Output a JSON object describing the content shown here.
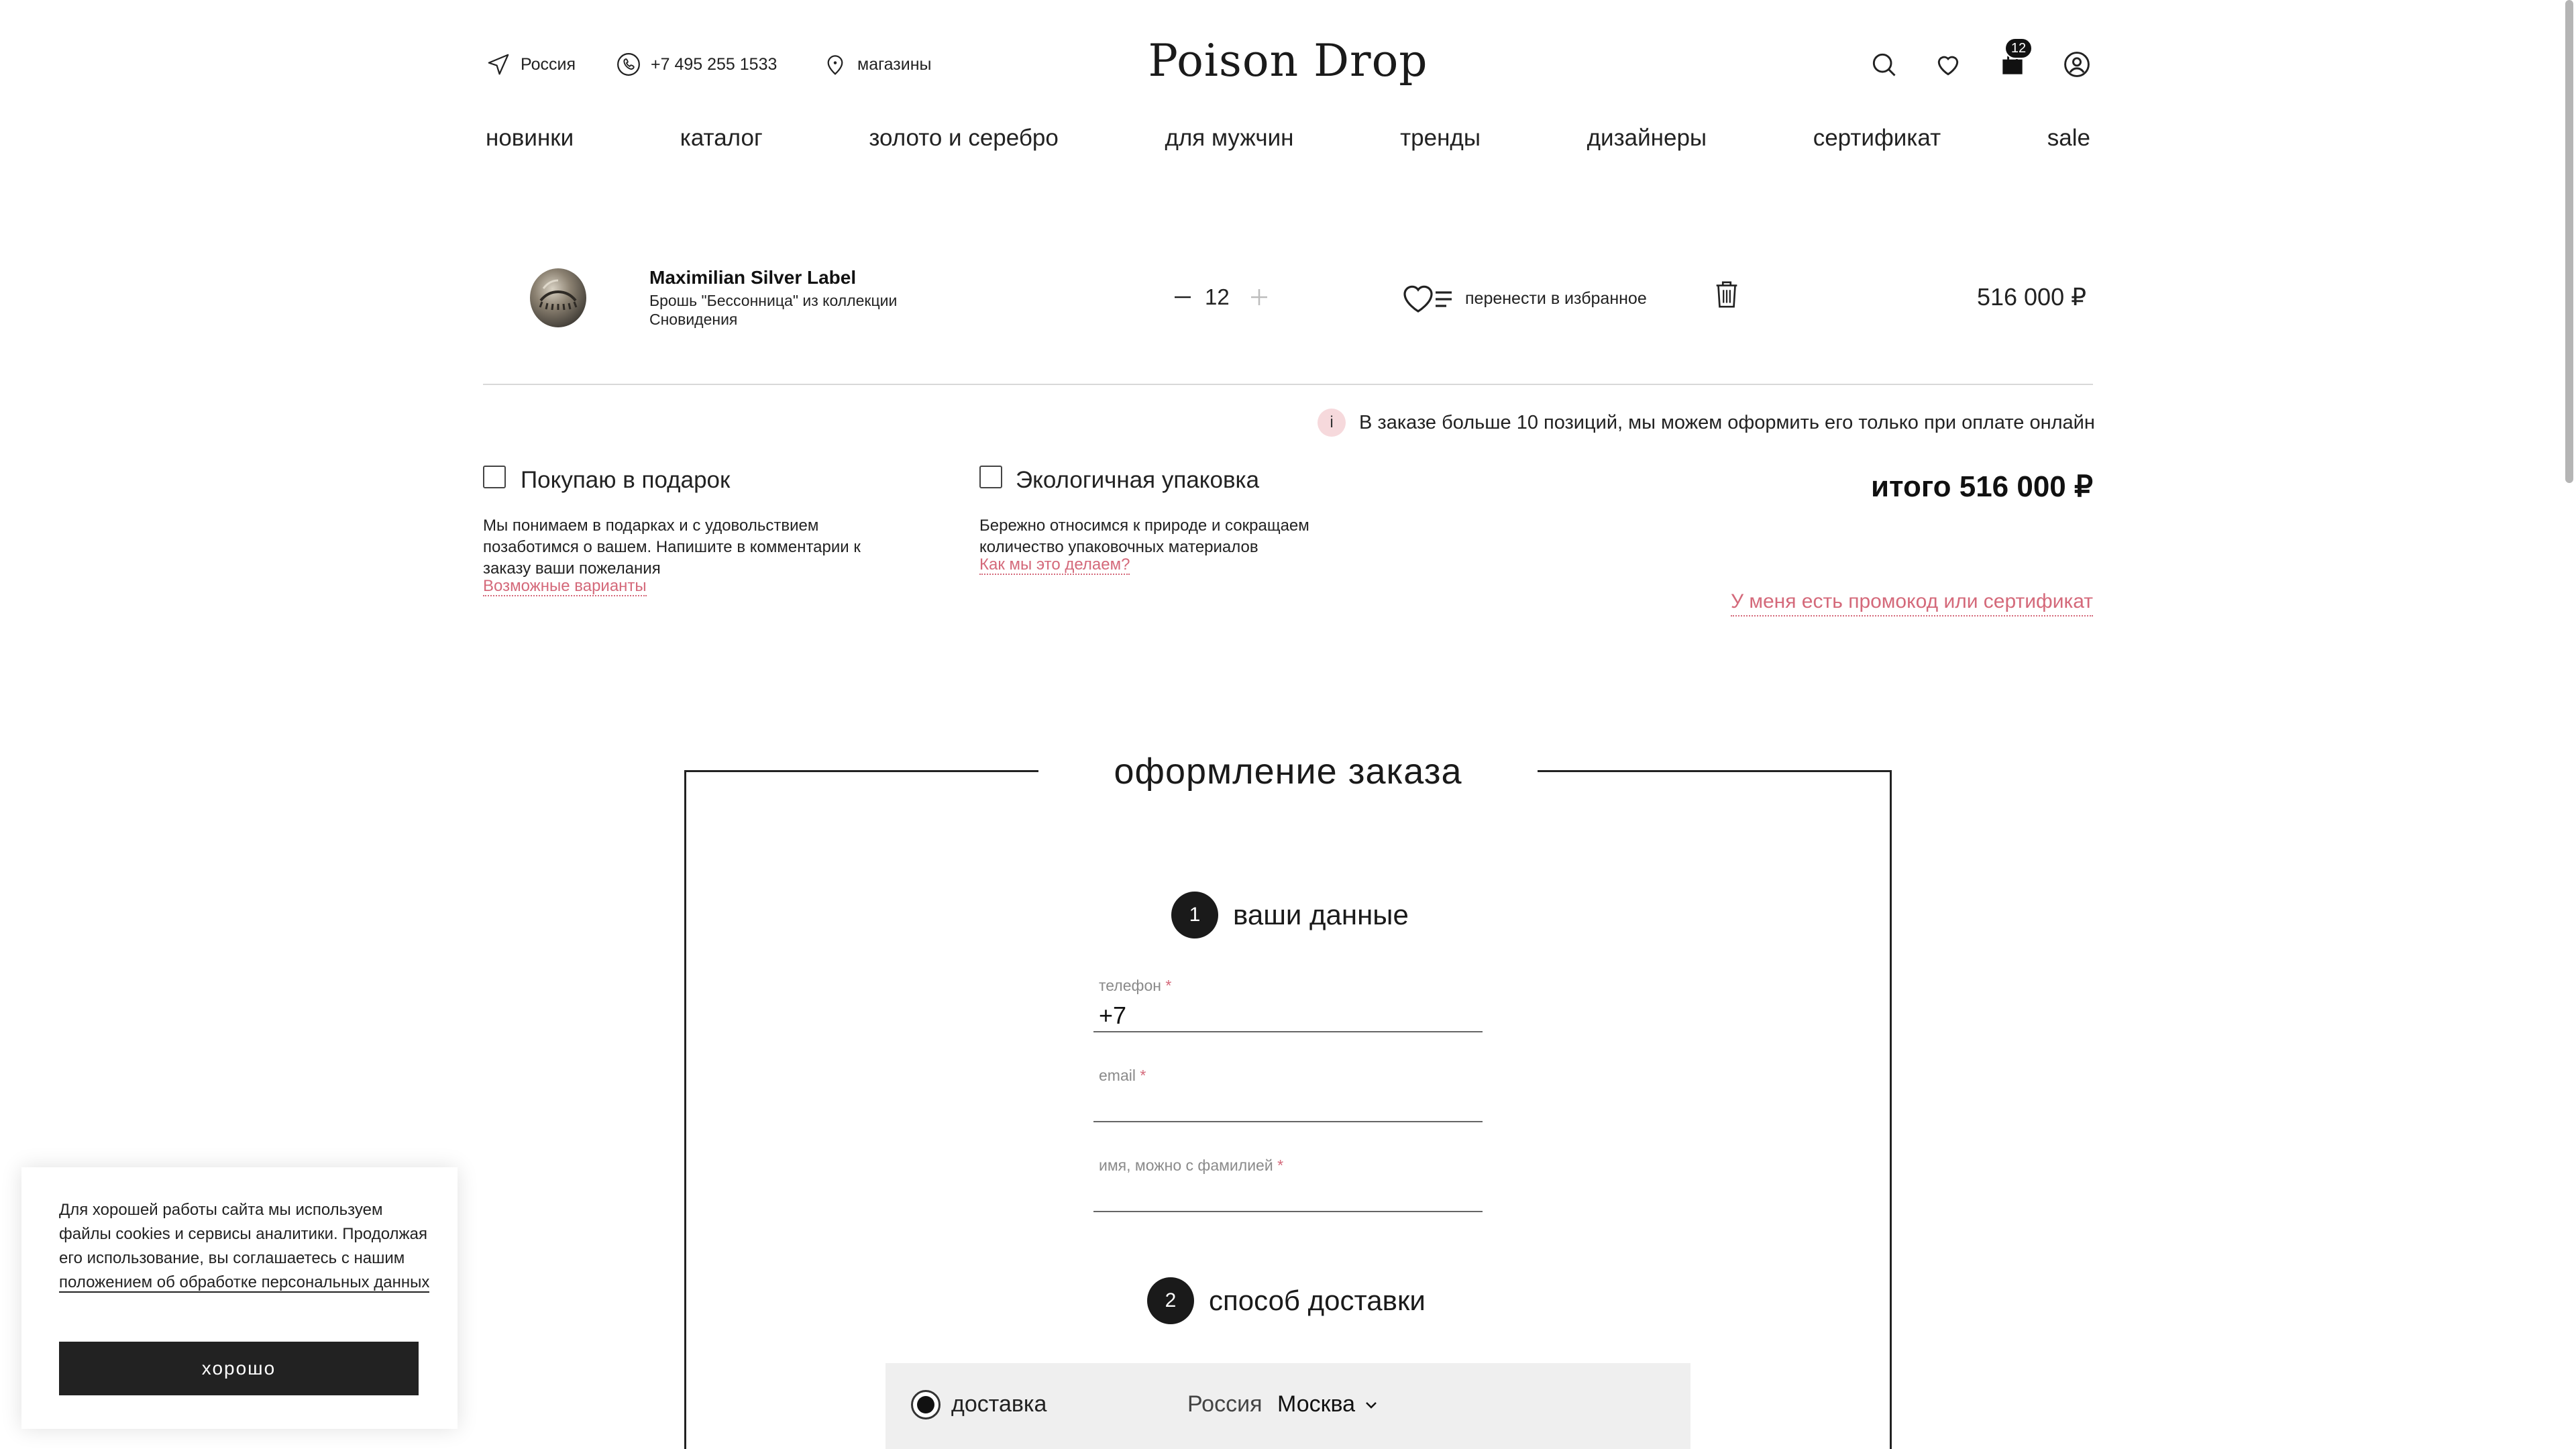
{
  "header": {
    "region_label": "Россия",
    "phone_label": "+7 495 255 1533",
    "stores_label": "магазины",
    "logo": "Poison Drop",
    "cart_count": "12"
  },
  "nav": {
    "items": [
      "новинки",
      "каталог",
      "золото и серебро",
      "для мужчин",
      "тренды",
      "дизайнеры",
      "сертификат",
      "sale"
    ]
  },
  "cart_item": {
    "brand": "Maximilian Silver Label",
    "description": "Брошь \"Бессонница\" из коллекции Сновидения",
    "quantity": "12",
    "move_to_favorites": "перенести в избранное",
    "price": "516 000 ₽"
  },
  "notice": {
    "icon_text": "i",
    "text": "В заказе больше 10 позиций, мы можем оформить его только при оплате онлайн"
  },
  "options": {
    "gift": {
      "title": "Покупаю в подарок",
      "text": "Мы понимаем в подарках и с удовольствием позаботимся о вашем. Напишите в комментарии к заказу ваши пожелания",
      "link": "Возможные варианты"
    },
    "eco": {
      "title": "Экологичная упаковка",
      "text": "Бережно относимся к природе и сокращаем количество упаковочных материалов",
      "link": "Как мы это делаем?"
    }
  },
  "summary": {
    "total": "итого 516 000 ₽",
    "promo_link": "У меня есть промокод или сертификат"
  },
  "checkout": {
    "title": "оформление заказа",
    "step1": {
      "number": "1",
      "title": "ваши данные"
    },
    "fields": {
      "phone": {
        "label": "телефон",
        "value": "+7"
      },
      "email": {
        "label": "email",
        "value": ""
      },
      "name": {
        "label": "имя, можно с фамилией",
        "value": ""
      },
      "required_mark": "*"
    },
    "step2": {
      "number": "2",
      "title": "способ доставки"
    },
    "delivery": {
      "option_label": "доставка",
      "country": "Россия",
      "city": "Москва"
    }
  },
  "cookie": {
    "text": "Для хорошей работы сайта мы используем файлы cookies и сервисы аналитики. Продолжая его использование, вы соглашаетесь с нашим",
    "link": "положением об обработке персональных данных",
    "button": "хорошо"
  },
  "colors": {
    "accent_pink": "#d4697a",
    "notice_bg": "#f6d9dc",
    "dark": "#1a1a1a"
  }
}
